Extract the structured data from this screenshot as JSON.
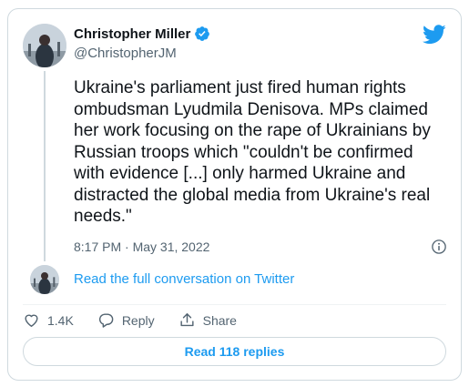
{
  "author": {
    "name": "Christopher Miller",
    "handle": "@ChristopherJM",
    "verified_icon": "verified-badge-icon"
  },
  "tweet": {
    "text": "Ukraine's parliament just fired human rights\nombudsman Lyudmila Denisova. MPs claimed\nher work focusing on the rape of Ukrainians by\nRussian troops which \"couldn't be confirmed\nwith evidence [...] only harmed Ukraine and\ndistracted the global media from Ukraine's real\nneeds.\"",
    "timestamp": "8:17 PM · May 31, 2022"
  },
  "conversation_link": "Read the full conversation on Twitter",
  "actions": {
    "like_count": "1.4K",
    "reply_label": "Reply",
    "share_label": "Share"
  },
  "replies_button": "Read 118 replies",
  "colors": {
    "accent": "#1d9bf0",
    "text": "#0f1419",
    "secondary": "#536471",
    "border": "#cfd9de"
  }
}
